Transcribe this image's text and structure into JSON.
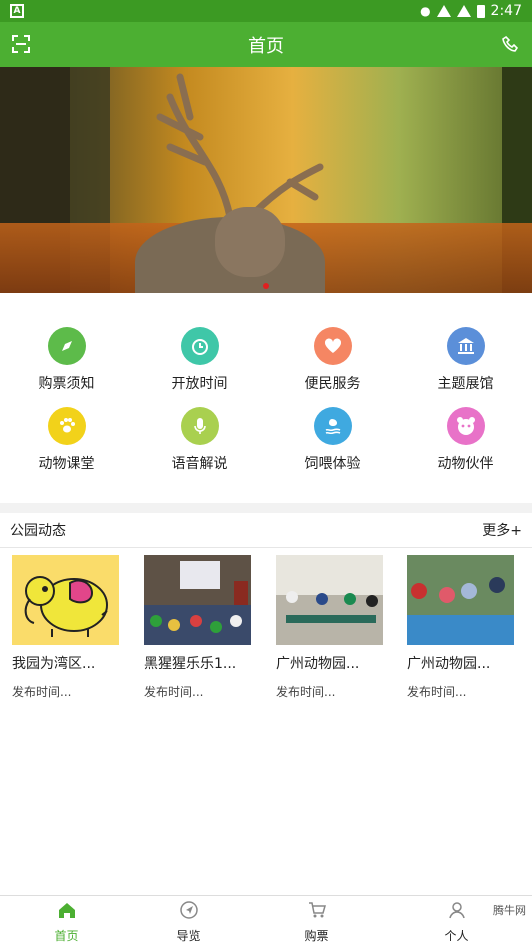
{
  "status_bar": {
    "time": "2:47"
  },
  "app_bar": {
    "title": "首页",
    "left_icon": "scan-icon",
    "right_icon": "phone-icon"
  },
  "banner": {
    "subject": "deer-in-forest",
    "active_dot_color": "#e02020"
  },
  "features": [
    {
      "label": "购票须知",
      "icon": "compass-icon",
      "color": "#5dbb4a"
    },
    {
      "label": "开放时间",
      "icon": "alarm-clock-icon",
      "color": "#3fc7a8"
    },
    {
      "label": "便民服务",
      "icon": "heart-hand-icon",
      "color": "#f58663"
    },
    {
      "label": "主题展馆",
      "icon": "museum-icon",
      "color": "#5b8fd9"
    },
    {
      "label": "动物课堂",
      "icon": "paw-icon",
      "color": "#f2d21a"
    },
    {
      "label": "语音解说",
      "icon": "microphone-icon",
      "color": "#a9d04f"
    },
    {
      "label": "饲喂体验",
      "icon": "feeding-icon",
      "color": "#3fa9e0"
    },
    {
      "label": "动物伙伴",
      "icon": "panda-icon",
      "color": "#e872c8"
    }
  ],
  "news_section": {
    "title": "公园动态",
    "more": "更多+"
  },
  "news": [
    {
      "title": "我园为湾区...",
      "time": "发布时间..."
    },
    {
      "title": "黑猩猩乐乐1...",
      "time": "发布时间..."
    },
    {
      "title": "广州动物园...",
      "time": "发布时间..."
    },
    {
      "title": "广州动物园...",
      "time": "发布时间..."
    }
  ],
  "tabs": [
    {
      "label": "首页",
      "icon": "home-icon"
    },
    {
      "label": "导览",
      "icon": "navigation-icon"
    },
    {
      "label": "购票",
      "icon": "cart-icon"
    },
    {
      "label": "个人",
      "icon": "person-icon"
    }
  ],
  "watermark": "腾牛网",
  "colors": {
    "primary_green": "#4caf32",
    "status_green": "#3c9a23"
  }
}
